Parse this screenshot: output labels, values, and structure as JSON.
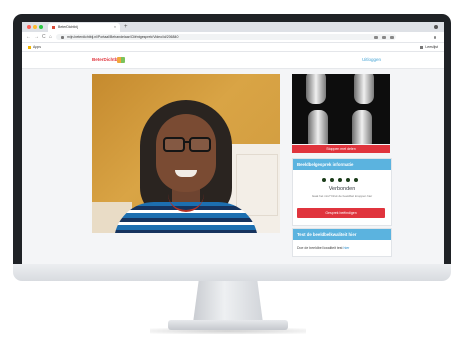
{
  "browser": {
    "tab_title": "BeterDichtbij",
    "tab_close": "×",
    "new_tab": "+",
    "url": "mijn.beterdichtbij.nl/Portaal/Behandelaar/Cliëntgesprek/Video/id/206840",
    "bookmarks_label": "Apps",
    "reading_list_label": "Leeslijst",
    "nav_back": "←",
    "nav_forward": "→",
    "nav_reload": "C",
    "nav_home": "⌂",
    "traffic_lights": [
      "#ff5f57",
      "#febc2e",
      "#28c840"
    ]
  },
  "site": {
    "logo_text": "BeterDichtbij",
    "logout_label": "Uitloggen"
  },
  "panel": {
    "stop_sharing_label": "Stoppen met delen",
    "call_info": {
      "title": "Beeldbelgesprek informatie",
      "status": "Verbonden",
      "help": "Gaat het mis? Druk de beeldbel knoppen hier",
      "end_call_label": "Gesprek beëindigen"
    },
    "quality_test": {
      "title": "Test de beeldbelkwaliteit hier",
      "prompt": "Doe de beeldbel kwaliteit test",
      "link": "hier"
    }
  },
  "colors": {
    "brand_red": "#e0343d",
    "accent_blue": "#5bb3df",
    "status_green": "#1c3d1a"
  }
}
